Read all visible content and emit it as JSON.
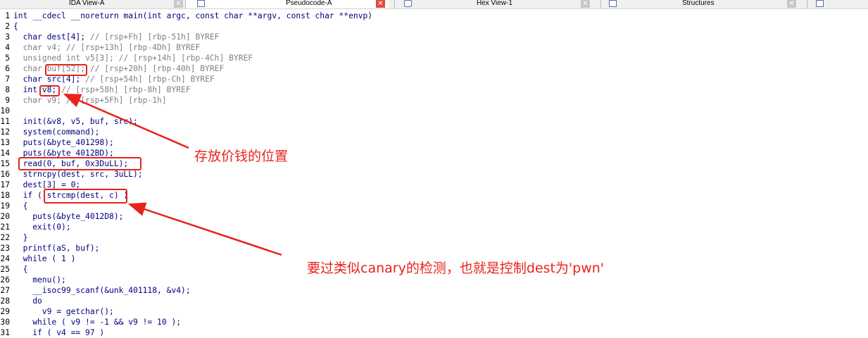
{
  "tabs": [
    {
      "label": "IDA View-A",
      "icon": "graph-icon",
      "active": false
    },
    {
      "label": "Pseudocode-A",
      "icon": "pseudocode-icon",
      "active": true
    },
    {
      "label": "Hex View-1",
      "icon": "hex-icon",
      "active": false
    },
    {
      "label": "Structures",
      "icon": "structures-icon",
      "active": false
    }
  ],
  "close_glyph": "✕",
  "code": {
    "lines": [
      {
        "n": "1",
        "text": "int __cdecl __noreturn main(int argc, const char **argv, const char **envp)"
      },
      {
        "n": "2",
        "text": "{"
      },
      {
        "n": "3",
        "text": "  char dest[4]; ",
        "comment": "// [rsp+Fh] [rbp-51h] BYREF"
      },
      {
        "n": "4",
        "text": "  char v4; ",
        "comment": "// [rsp+13h] [rbp-4Dh] BYREF",
        "grey": true
      },
      {
        "n": "5",
        "text": "  unsigned int v5[3]; ",
        "comment": "// [rsp+14h] [rbp-4Ch] BYREF",
        "grey": true
      },
      {
        "n": "6",
        "text": "  char buf[52]; ",
        "comment": "// [rsp+20h] [rbp-40h] BYREF",
        "grey": true
      },
      {
        "n": "7",
        "text": "  char src[4]; ",
        "comment": "// [rsp+54h] [rbp-Ch] BYREF"
      },
      {
        "n": "8",
        "text": "  int v8; ",
        "comment": "// [rsp+58h] [rbp-8h] BYREF"
      },
      {
        "n": "9",
        "text": "  char v9; ",
        "comment": "// [rsp+5Fh] [rbp-1h]",
        "grey": true
      },
      {
        "n": "10",
        "text": ""
      },
      {
        "n": "11",
        "text": "  init(&v8, v5, buf, src);"
      },
      {
        "n": "12",
        "text": "  system(command);"
      },
      {
        "n": "13",
        "text": "  puts(&byte_401298);"
      },
      {
        "n": "14",
        "text": "  puts(&byte_4012BD);"
      },
      {
        "n": "15",
        "text": "  read(0, buf, 0x3DuLL);"
      },
      {
        "n": "16",
        "text": "  strncpy(dest, src, 3uLL);"
      },
      {
        "n": "17",
        "text": "  dest[3] = 0;"
      },
      {
        "n": "18",
        "text": "  if ( strcmp(dest, c) )"
      },
      {
        "n": "19",
        "text": "  {"
      },
      {
        "n": "20",
        "text": "    puts(&byte_4012D8);"
      },
      {
        "n": "21",
        "text": "    exit(0);"
      },
      {
        "n": "22",
        "text": "  }"
      },
      {
        "n": "23",
        "text": "  printf(aS, buf);"
      },
      {
        "n": "24",
        "text": "  while ( 1 )"
      },
      {
        "n": "25",
        "text": "  {"
      },
      {
        "n": "26",
        "text": "    menu();"
      },
      {
        "n": "27",
        "text": "    __isoc99_scanf(&unk_401118, &v4);"
      },
      {
        "n": "28",
        "text": "    do"
      },
      {
        "n": "29",
        "text": "      v9 = getchar();"
      },
      {
        "n": "30",
        "text": "    while ( v9 != -1 && v9 != 10 );"
      },
      {
        "n": "31",
        "text": "    if ( v4 == 97 )"
      }
    ]
  },
  "annotations": {
    "price_location": "存放价钱的位置",
    "canary_check": "要过类似canary的检测，也就是控制dest为'pwn'"
  },
  "colors": {
    "annotation": "#e8231a",
    "code_text": "#000080",
    "comment": "#808080",
    "active_close": "#e04a3c"
  }
}
